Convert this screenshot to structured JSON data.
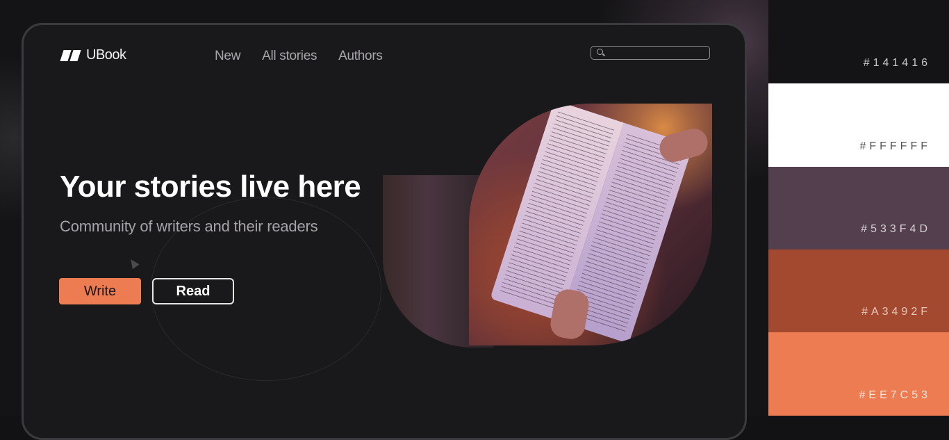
{
  "brand": {
    "name": "UBook",
    "logo_icon": "ubook-logo-icon"
  },
  "nav": {
    "items": [
      "New",
      "All stories",
      "Authors"
    ]
  },
  "search": {
    "placeholder": "",
    "icon": "search-icon"
  },
  "hero": {
    "title": "Your stories live here",
    "subtitle": "Community of writers and their readers",
    "write_label": "Write",
    "read_label": "Read"
  },
  "palette": {
    "swatches": [
      {
        "hex": "#141416",
        "label": "#141416",
        "text_color": "#c8c8c8"
      },
      {
        "hex": "#FFFFFF",
        "label": "#FFFFFF",
        "text_color": "#555555"
      },
      {
        "hex": "#533F4D",
        "label": "#533F4D",
        "text_color": "#d8d0d6"
      },
      {
        "hex": "#A3492F",
        "label": "#A3492F",
        "text_color": "#e8c8bc"
      },
      {
        "hex": "#EE7C53",
        "label": "#EE7C53",
        "text_color": "#fde8df"
      }
    ]
  },
  "colors": {
    "accent": "#ee7c53",
    "background": "#141416"
  }
}
